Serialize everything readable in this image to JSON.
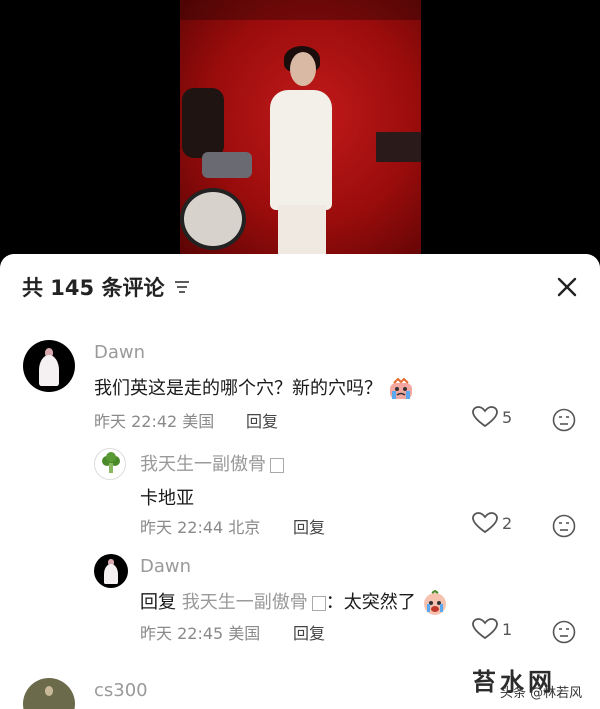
{
  "comments_header": {
    "count_label": "共 145 条评论"
  },
  "comments": [
    {
      "username": "Dawn",
      "text": "我们英这是走的哪个穴？新的穴吗？",
      "time": "昨天 22:42",
      "location": "美国",
      "reply_label": "回复",
      "likes": "5",
      "emoji_icon": "crying-emoji-icon"
    },
    {
      "username": "我天生一副傲骨",
      "text": "卡地亚",
      "time": "昨天 22:44",
      "location": "北京",
      "reply_label": "回复",
      "likes": "2"
    },
    {
      "username": "Dawn",
      "reply_prefix": "回复",
      "reply_target": "我天生一副傲骨",
      "text": "：太突然了",
      "time": "昨天 22:45",
      "location": "美国",
      "reply_label": "回复",
      "likes": "1",
      "emoji_icon": "crying-emoji-icon"
    },
    {
      "username": "cs300"
    }
  ],
  "watermark": {
    "logo_text": "苔水网",
    "caption": "头条 @林若风"
  },
  "colors": {
    "stage_red": "#c21a1a",
    "like_heart": "#555555",
    "muted_text": "#9a9a9a"
  }
}
